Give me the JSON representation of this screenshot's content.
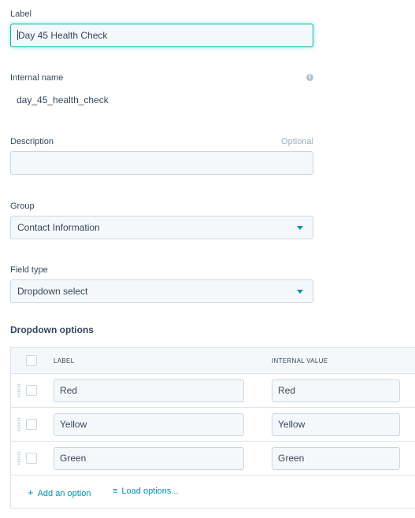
{
  "label_field": {
    "label": "Label",
    "value": "Day 45 Health Check"
  },
  "internal_name": {
    "label": "Internal name",
    "value": "day_45_health_check"
  },
  "description": {
    "label": "Description",
    "optional": "Optional",
    "value": ""
  },
  "group": {
    "label": "Group",
    "selected": "Contact Information"
  },
  "field_type": {
    "label": "Field type",
    "selected": "Dropdown select"
  },
  "dropdown_options": {
    "title": "Dropdown options",
    "headers": {
      "label": "LABEL",
      "internal_value": "INTERNAL VALUE"
    },
    "rows": [
      {
        "label": "Red",
        "value": "Red"
      },
      {
        "label": "Yellow",
        "value": "Yellow"
      },
      {
        "label": "Green",
        "value": "Green"
      }
    ],
    "add_option": "Add an option",
    "load_options": "Load options..."
  },
  "colors": {
    "accent": "#0091ae",
    "focus": "#00bda5",
    "input_bg": "#f5f8fa",
    "border": "#cbd6e2"
  }
}
